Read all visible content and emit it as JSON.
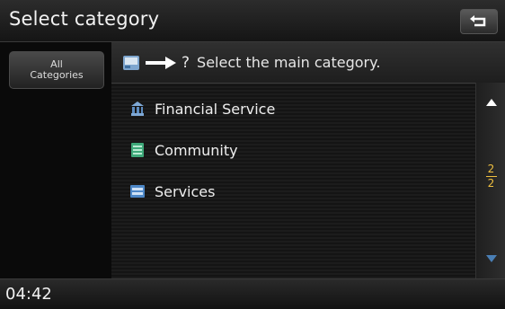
{
  "header": {
    "title": "Select category"
  },
  "sidebar": {
    "tab_label": "All\nCategories"
  },
  "instruction": {
    "question_mark": "?",
    "text": "Select the main category."
  },
  "list": {
    "items": [
      {
        "label": "Financial Service",
        "icon": "bank-icon"
      },
      {
        "label": "Community",
        "icon": "community-icon"
      },
      {
        "label": "Services",
        "icon": "services-icon"
      }
    ]
  },
  "scroll": {
    "page_current": "2",
    "page_total": "2"
  },
  "footer": {
    "time": "04:42"
  },
  "colors": {
    "accent": "#f0c040",
    "background": "#000000"
  }
}
